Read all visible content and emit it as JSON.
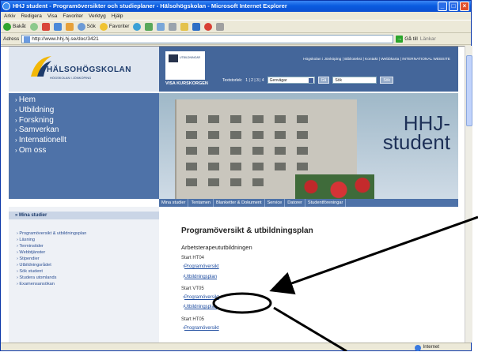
{
  "window": {
    "title": "HHJ student - Programöversikter och studieplaner - Hälsohögskolan - Microsoft Internet Explorer"
  },
  "menu": [
    "Arkiv",
    "Redigera",
    "Visa",
    "Favoriter",
    "Verktyg",
    "Hjälp"
  ],
  "toolbar": {
    "back": "Bakåt",
    "search": "Sök",
    "favorites": "Favoriter"
  },
  "address": {
    "label": "Adress",
    "url": "http://www.hhj.hj.se/doc/3421",
    "go": "Gå till",
    "links": "Länkar"
  },
  "site": {
    "logo_name": "HÄLSOHÖGSKOLAN",
    "logo_sub": "HÖGSKOLAN I JÖNKÖPING",
    "badge": "UTBILDNINGAR",
    "visa": "VISA KURSKORGEN",
    "top_links": "Högskolan i Jönköping | Bibliotekst | Kontakt | Webbkarta | INTERNATIONAL WEBSITE",
    "textsize_label": "Textstorlek:",
    "textsize_options": "1 | 2 | 3 | 4",
    "genvagar": "Genvägar",
    "ga": "Gå",
    "sok": "Sök",
    "sok_btn": "Sök",
    "nav": [
      "Hem",
      "Utbildning",
      "Forskning",
      "Samverkan",
      "Internationellt",
      "Om oss"
    ],
    "hero_title": "HHJ-\nstudent",
    "tabs": [
      "Mina studier",
      "Tentamen",
      "Blanketter & Dokument",
      "Service",
      "Datorer",
      "Studentföreningar"
    ],
    "mina_studier_title": "Mina studier",
    "mina_studier": [
      "Programöversikt & utbildningsplan",
      "Läsning",
      "Terminstider",
      "Webbtjänster",
      "Stipendier",
      "Utbildningsrådet",
      "Sök student",
      "Studera utomlands",
      "Examensansökan"
    ],
    "heading": "Programöversikt & utbildningsplan",
    "subheading": "Arbetsterapeututbildningen",
    "terms": [
      {
        "label": "Start HT04",
        "link1": "Programöversikt",
        "link2": "Utbildningsplan"
      },
      {
        "label": "Start VT05",
        "link1": "Programöversikt",
        "link2": "Utbildningsplan"
      },
      {
        "label": "Start HT05",
        "link1": "Programöversikt",
        "link2": ""
      }
    ]
  },
  "status": {
    "zone": "Internet"
  }
}
